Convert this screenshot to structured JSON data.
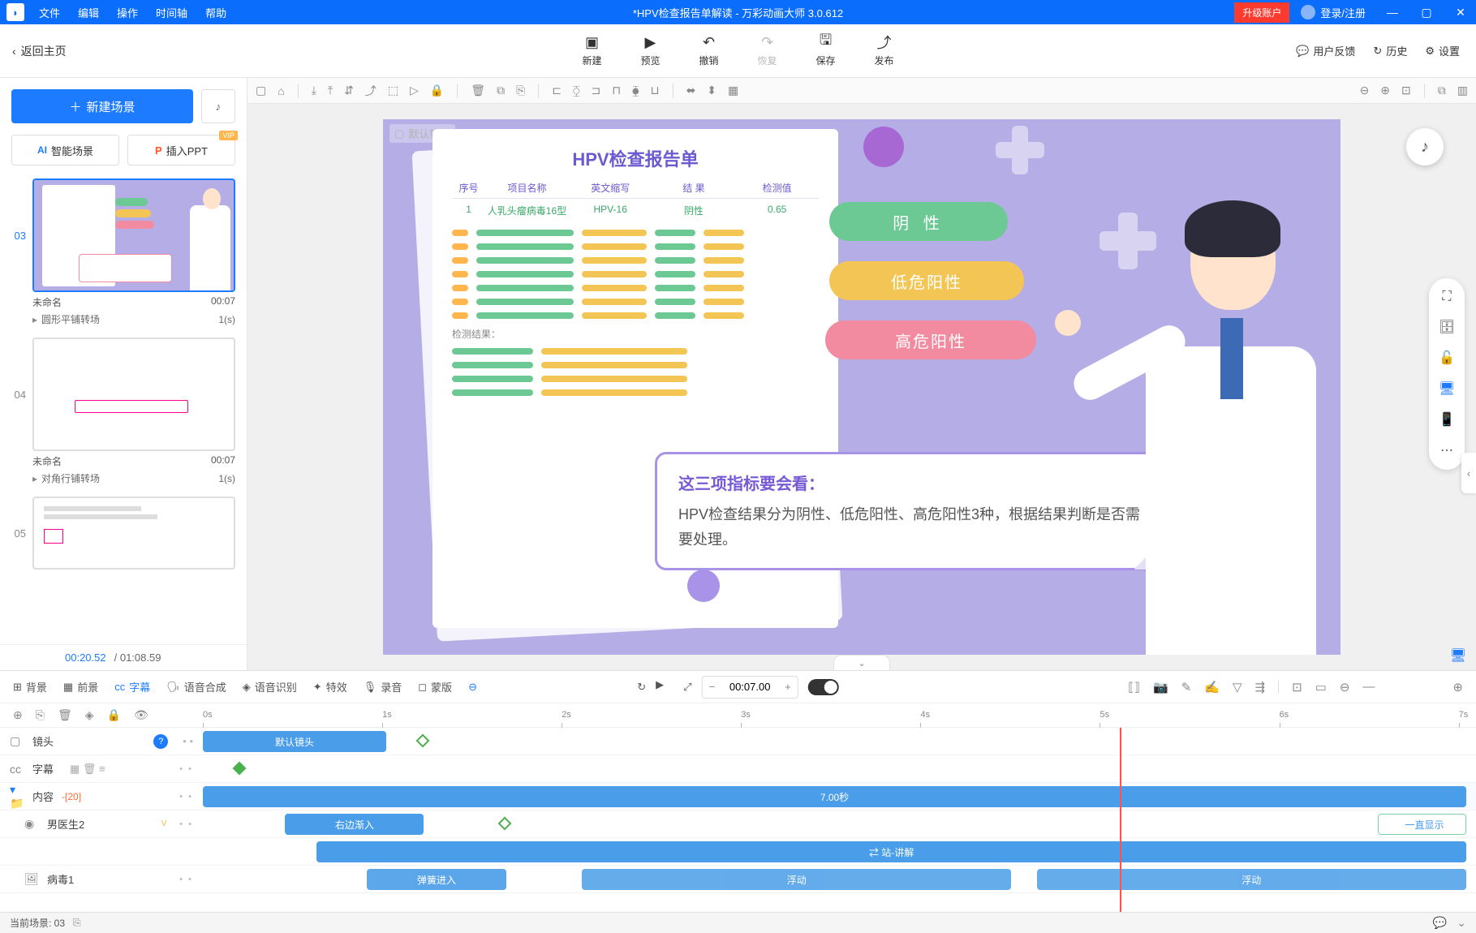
{
  "titlebar": {
    "menus": [
      "文件",
      "编辑",
      "操作",
      "时间轴",
      "帮助"
    ],
    "title": "*HPV检查报告单解读 - 万彩动画大师 3.0.612",
    "upgrade": "升级账户",
    "login": "登录/注册"
  },
  "back": "返回主页",
  "topactions": {
    "new": "新建",
    "preview": "预览",
    "undo": "撤销",
    "redo": "恢复",
    "save": "保存",
    "publish": "发布"
  },
  "toplinks": {
    "feedback": "用户反馈",
    "history": "历史",
    "settings": "设置"
  },
  "left": {
    "new_scene": "新建场景",
    "ai_scene": "智能场景",
    "insert_ppt": "插入PPT",
    "vip": "VIP",
    "scenes": [
      {
        "num": "03",
        "name": "未命名",
        "time": "00:07",
        "transition": "圆形平铺转场",
        "t_dur": "1(s)"
      },
      {
        "num": "04",
        "name": "未命名",
        "time": "00:07",
        "transition": "对角行铺转场",
        "t_dur": "1(s)"
      },
      {
        "num": "05",
        "name": "",
        "time": ""
      }
    ],
    "cur_time": "00:20.52",
    "total_time": "/ 01:08.59"
  },
  "stage": {
    "camera_label": "默认镜头",
    "report_title": "HPV检查报告单",
    "headers": [
      "序号",
      "项目名称",
      "英文缩写",
      "结 果",
      "检测值"
    ],
    "row1": [
      "1",
      "人乳头瘤病毒16型",
      "HPV-16",
      "阴性",
      "0.65"
    ],
    "result_label": "检测结果：",
    "pill_neg": "阴   性",
    "pill_low": "低危阳性",
    "pill_high": "高危阳性",
    "speech_title": "这三项指标要会看：",
    "speech_body": "HPV检查结果分为阴性、低危阳性、高危阳性3种，根据结果判断是否需要处理。"
  },
  "timeline": {
    "tabs": {
      "bg": "背景",
      "fg": "前景",
      "subtitle": "字幕",
      "tts": "语音合成",
      "asr": "语音识别",
      "fx": "特效",
      "rec": "录音",
      "mask": "蒙版"
    },
    "time_value": "00:07.00",
    "ruler": [
      "0s",
      "1s",
      "2s",
      "3s",
      "4s",
      "5s",
      "6s",
      "7s"
    ],
    "tracks": {
      "camera": "镜头",
      "camera_clip": "默认镜头",
      "subtitle": "字幕",
      "content": "内容",
      "content_count": "-[20]",
      "content_dur": "7.00秒",
      "doctor": "男医生2",
      "doctor_in": "右边渐入",
      "doctor_stay": "一直显示",
      "doctor_act": "⇄ 站-讲解",
      "virus": "病毒1",
      "virus_in": "弹簧进入",
      "virus_float1": "浮动",
      "virus_float2": "浮动"
    }
  },
  "status": {
    "scene": "当前场景: 03"
  }
}
